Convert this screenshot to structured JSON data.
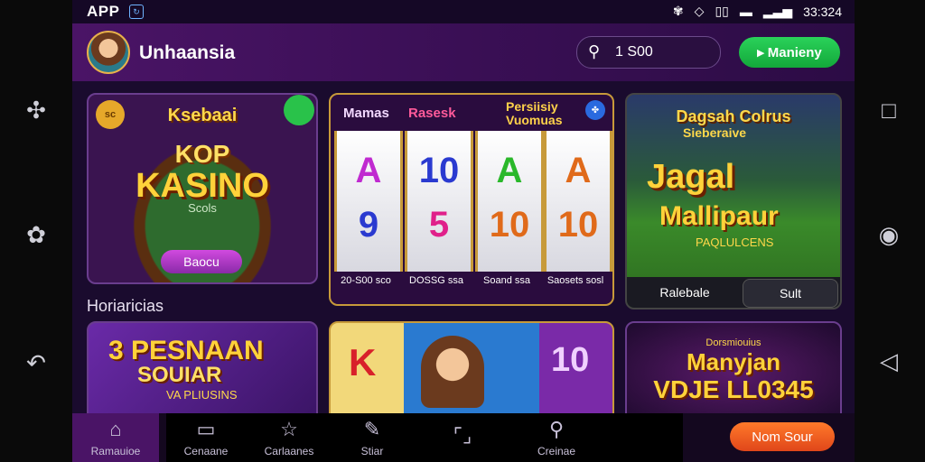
{
  "status_bar": {
    "label": "APP",
    "time": "33:324",
    "icons": [
      "sync-icon",
      "wifi-icon",
      "vibrate-icon",
      "battery-icon",
      "signal-icon"
    ]
  },
  "left_rail": {
    "icons": [
      "network-icon",
      "puzzle-icon",
      "undo-icon"
    ]
  },
  "right_rail": {
    "icons": [
      "square-icon",
      "compass-icon",
      "back-triangle-icon"
    ]
  },
  "header": {
    "brand": "Unhaansia",
    "search_value": "1 S00",
    "cta_label": "Manieny"
  },
  "cards": {
    "kasino": {
      "title": "Ksebaai",
      "subtitle": "KOP",
      "main": "KASINO",
      "sub2": "Scols",
      "button": "Baocu",
      "coin": "sc"
    },
    "slots": {
      "header_1": "Mamas",
      "header_2": "Rasesk",
      "header_3": "Persiisiy Vuomuas",
      "reels": [
        {
          "top": "A",
          "bottom": "9",
          "top_color": "#c02ad0",
          "bottom_color": "#2a3ad0",
          "label": "20-S00 sco"
        },
        {
          "top": "10",
          "bottom": "5",
          "top_color": "#2a3ad0",
          "bottom_color": "#e0208a",
          "label": "DOSSG ssa"
        },
        {
          "top": "A",
          "bottom": "10",
          "top_color": "#2ab82a",
          "bottom_color": "#e06a1a",
          "label": "Soand ssa"
        },
        {
          "top": "A",
          "bottom": "10",
          "top_color": "#e06a1a",
          "bottom_color": "#e06a1a",
          "label": "Saosets sosl"
        }
      ]
    },
    "jagal": {
      "header": "Dagsah Colrus",
      "sub": "Sieberaive",
      "title_1": "Jagal",
      "title_2": "Mallipaur",
      "sub2": "PAQLULCENS",
      "btn_left": "Ralebale",
      "btn_right": "Sult"
    },
    "pesnaan": {
      "num": "3",
      "title_1": "PESNAAN",
      "title_2": "SOUIAR",
      "sub": "VA PLIUSINS"
    },
    "k10": {
      "left": "K",
      "right": "10"
    },
    "vdje": {
      "small": "Dorsmiouius",
      "title_1": "Manyjan",
      "title_2": "VDJE LL0345"
    }
  },
  "section_title": "Horiaricias",
  "nav": {
    "items": [
      {
        "label": "Ramauioe",
        "icon": "home-icon"
      },
      {
        "label": "Cenaane",
        "icon": "chat-icon"
      },
      {
        "label": "Carlaanes",
        "icon": "star-icon"
      },
      {
        "label": "Stiar",
        "icon": "pen-icon"
      },
      {
        "label": "",
        "icon": "frame-icon"
      },
      {
        "label": "Creinae",
        "icon": "search-icon"
      }
    ],
    "pill": "Nom Sour"
  },
  "colors": {
    "accent_green": "#1fbf4a",
    "accent_purple": "#4a1466",
    "accent_orange": "#f26a22"
  }
}
